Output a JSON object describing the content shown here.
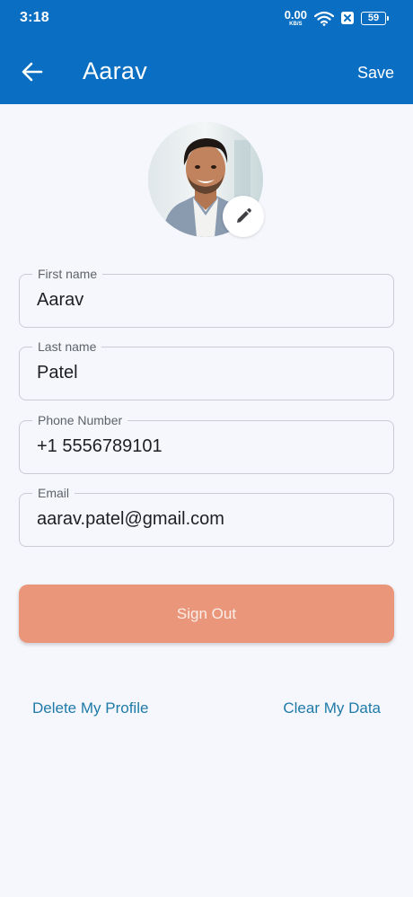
{
  "status_bar": {
    "time": "3:18",
    "net_speed_value": "0.00",
    "net_speed_unit": "KB/S",
    "battery_level": "59"
  },
  "app_bar": {
    "title": "Aarav",
    "save_label": "Save",
    "background_color": "#0a6fc2"
  },
  "profile": {
    "avatar_alt": "profile photo",
    "edit_icon": "pencil-icon"
  },
  "form": {
    "first_name": {
      "label": "First name",
      "value": "Aarav"
    },
    "last_name": {
      "label": "Last name",
      "value": "Patel"
    },
    "phone": {
      "label": "Phone Number",
      "value": "+1 5556789101"
    },
    "email": {
      "label": "Email",
      "value": "aarav.patel@gmail.com"
    }
  },
  "actions": {
    "sign_out_label": "Sign Out",
    "sign_out_color": "#e9967a",
    "delete_profile_label": "Delete My Profile",
    "clear_data_label": "Clear My Data",
    "link_color": "#1f7aa8"
  }
}
